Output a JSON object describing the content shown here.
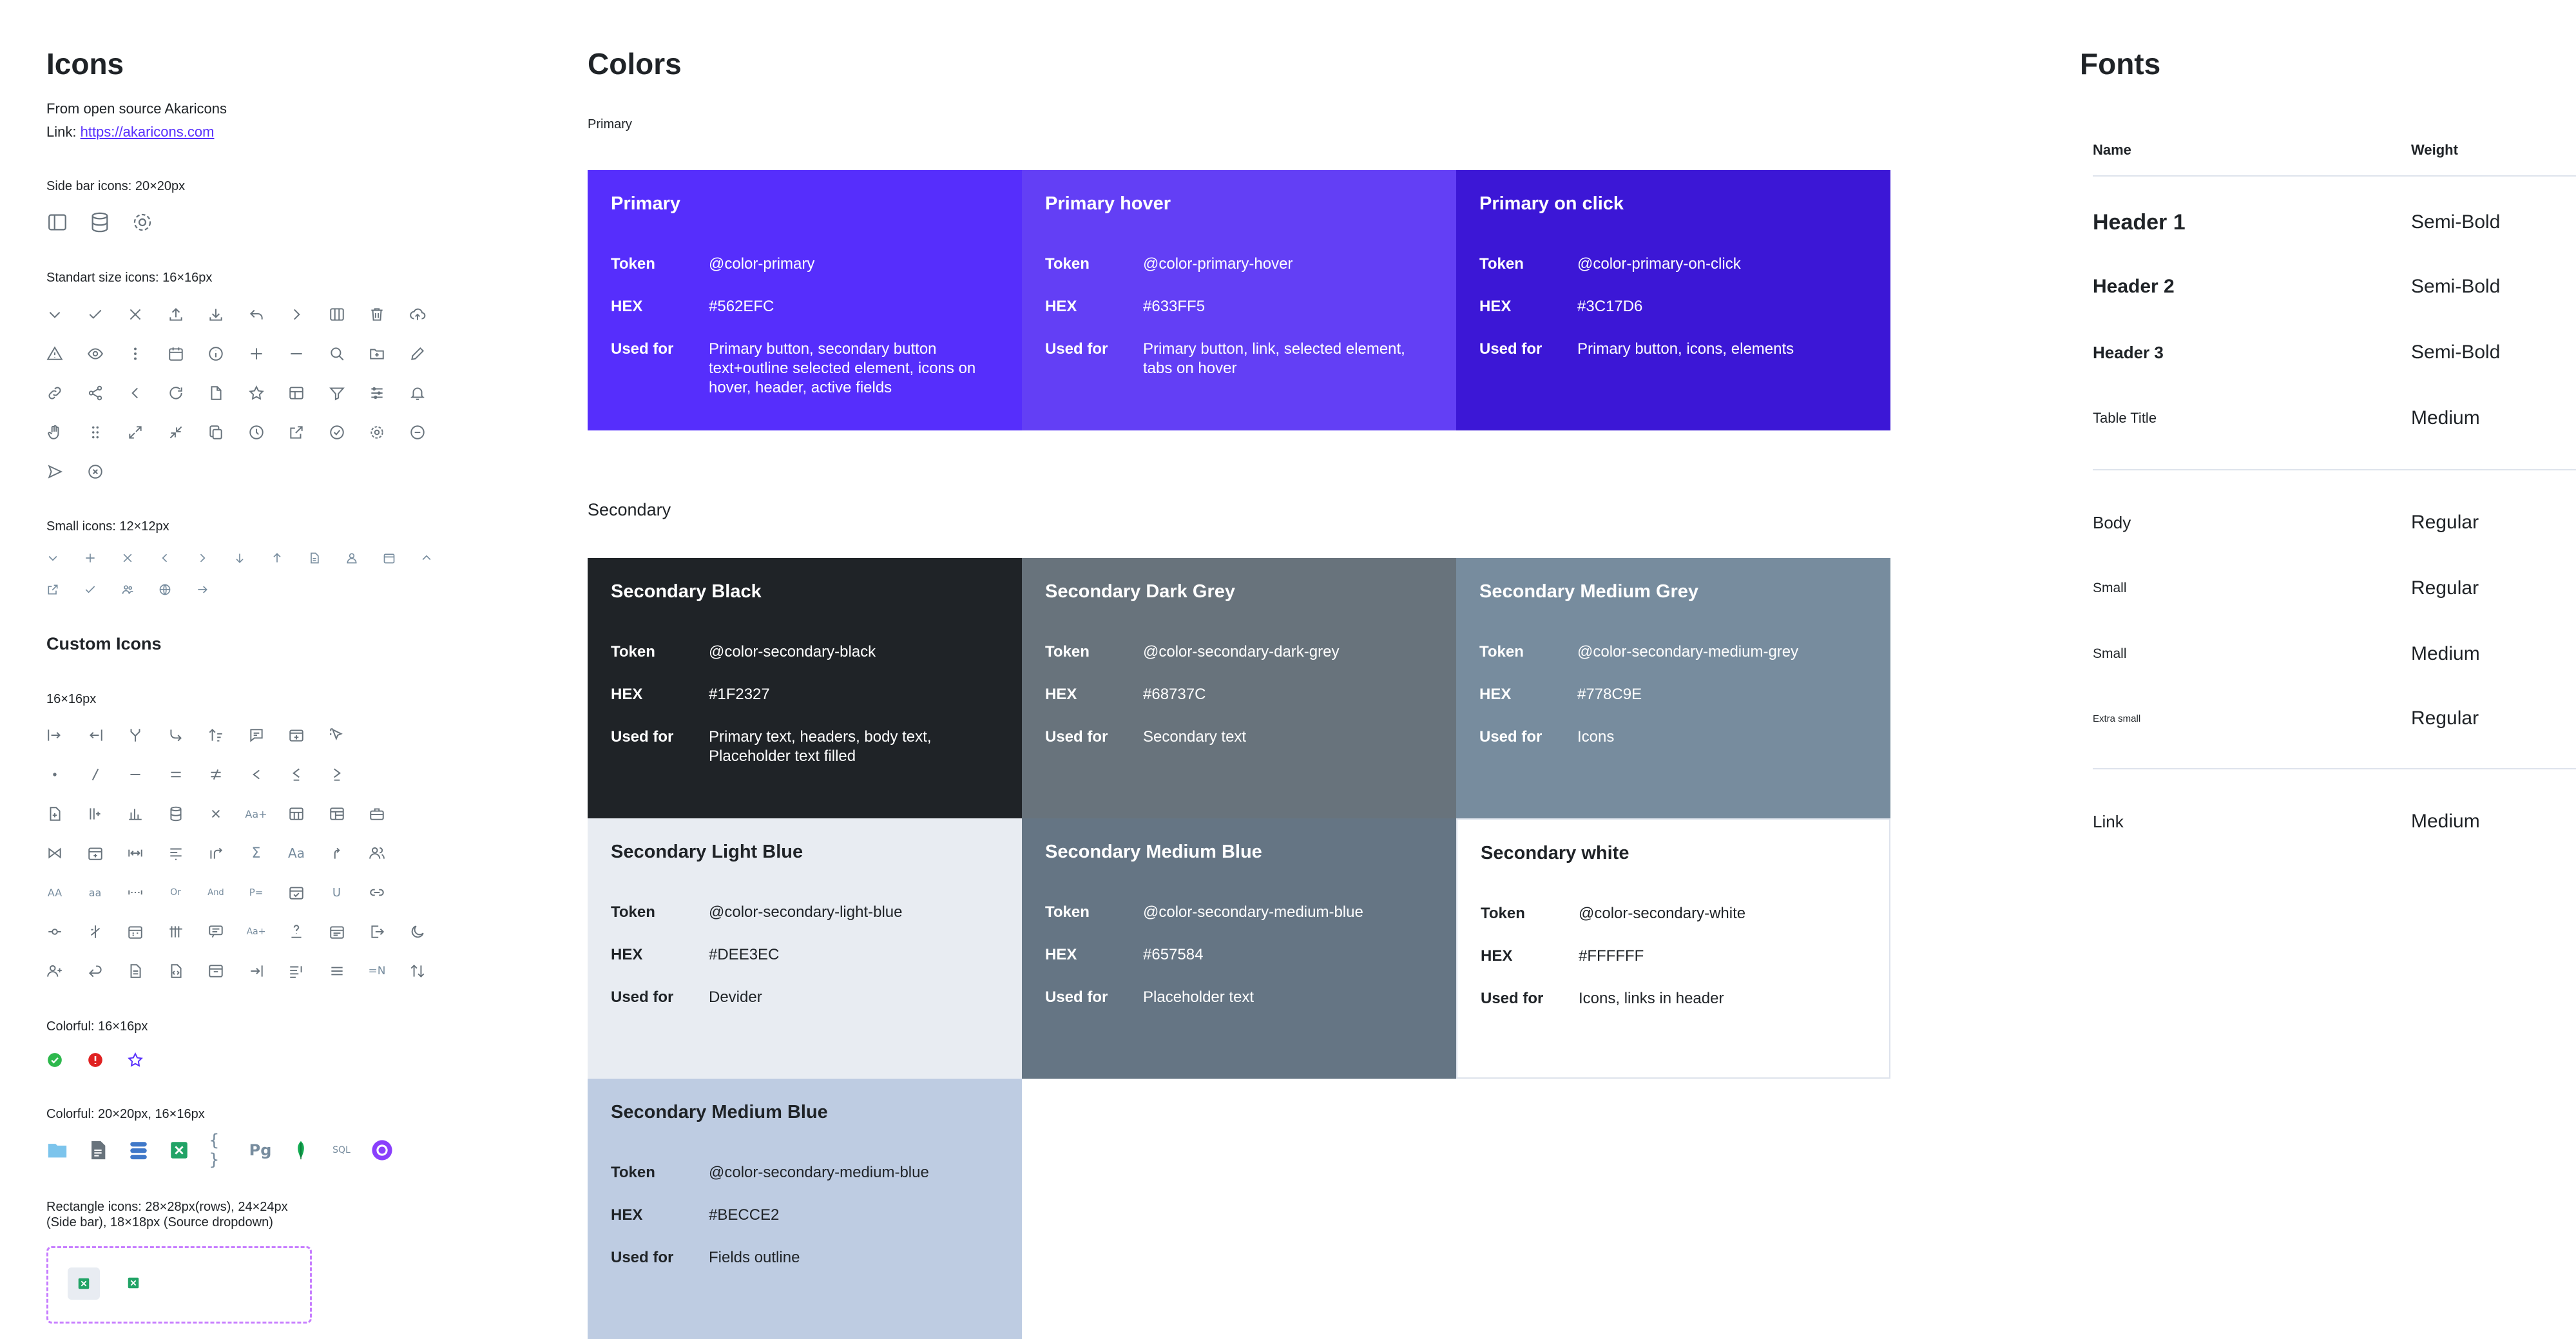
{
  "icons": {
    "title": "Icons",
    "source_line": "From open source Akaricons",
    "link_prefix": "Link: ",
    "link_text": "https://akaricons.com",
    "sidebar_label": "Side bar icons: 20×20px",
    "standard_label": "Standart size icons: 16×16px",
    "small_label": "Small icons: 12×12px",
    "custom_title": "Custom Icons",
    "custom_size_label": "16×16px",
    "colorful_label": "Colorful: 16×16px",
    "colorful2_label": "Colorful: 20×20px, 16×16px",
    "rect_label_1": "Rectangle icons: 28×28px(rows), 24×24px",
    "rect_label_2": "(Side bar), 18×18px (Source dropdown)",
    "custom_text_icons": [
      "AA",
      "aa",
      "Aa+",
      "Aa",
      "Or",
      "And",
      "P=",
      "Σ",
      "≠",
      "=N",
      "SQL",
      "Pg",
      "{ }",
      "U"
    ]
  },
  "colors": {
    "title": "Colors",
    "primary_label": "Primary",
    "secondary_label": "Secondary",
    "token_key": "Token",
    "hex_key": "HEX",
    "used_key": "Used for",
    "primary": [
      {
        "name": "Primary",
        "token": "@color-primary",
        "hex": "#562EFC",
        "used": "Primary button, secondary button text+outline selected element, icons on hover, header, active fields",
        "bg": "#562EFC",
        "fg": "#FFFFFF"
      },
      {
        "name": "Primary hover",
        "token": "@color-primary-hover",
        "hex": "#633FF5",
        "used": "Primary button, link, selected element, tabs on hover",
        "bg": "#633FF5",
        "fg": "#FFFFFF"
      },
      {
        "name": "Primary on click",
        "token": "@color-primary-on-click",
        "hex": "#3C17D6",
        "used": "Primary button, icons, elements",
        "bg": "#3C17D6",
        "fg": "#FFFFFF"
      }
    ],
    "secondary": [
      {
        "name": "Secondary Black",
        "token": "@color-secondary-black",
        "hex": "#1F2327",
        "used": "Primary text, headers, body text, Placeholder text filled",
        "bg": "#1F2327",
        "fg": "#FFFFFF"
      },
      {
        "name": "Secondary Dark Grey",
        "token": "@color-secondary-dark-grey",
        "hex": "#68737C",
        "used": "Secondary text",
        "bg": "#68737C",
        "fg": "#FFFFFF"
      },
      {
        "name": "Secondary Medium Grey",
        "token": "@color-secondary-medium-grey",
        "hex": "#778C9E",
        "used": "Icons",
        "bg": "#778C9E",
        "fg": "#FFFFFF"
      },
      {
        "name": "Secondary Light Blue",
        "token": "@color-secondary-light-blue",
        "hex": "#DEE3EC",
        "used": "Devider",
        "bg": "#E8ECF2",
        "fg": "#1F2327"
      },
      {
        "name": "Secondary Medium Blue",
        "token": "@color-secondary-medium-blue",
        "hex": "#657584",
        "used": "Placeholder text",
        "bg": "#657584",
        "fg": "#FFFFFF"
      },
      {
        "name": "Secondary white",
        "token": "@color-secondary-white",
        "hex": "#FFFFFF",
        "used": "Icons, links in header",
        "bg": "#FFFFFF",
        "fg": "#1F2327"
      },
      {
        "name": "Secondary Medium Blue",
        "token": "@color-secondary-medium-blue",
        "hex": "#BECCE2",
        "used": "Fields outline",
        "bg": "#BECCE2",
        "fg": "#1F2327"
      }
    ]
  },
  "fonts": {
    "title": "Fonts",
    "col_name": "Name",
    "col_weight": "Weight",
    "rows": [
      {
        "name": "Header 1",
        "weight": "Semi-Bold"
      },
      {
        "name": "Header 2",
        "weight": "Semi-Bold"
      },
      {
        "name": "Header 3",
        "weight": "Semi-Bold"
      },
      {
        "name": "Table Title",
        "weight": "Medium"
      },
      {
        "name": "Body",
        "weight": "Regular"
      },
      {
        "name": "Small",
        "weight": "Regular"
      },
      {
        "name": "Small",
        "weight": "Medium"
      },
      {
        "name": "Extra small",
        "weight": "Regular"
      },
      {
        "name": "Link",
        "weight": "Medium"
      }
    ]
  }
}
